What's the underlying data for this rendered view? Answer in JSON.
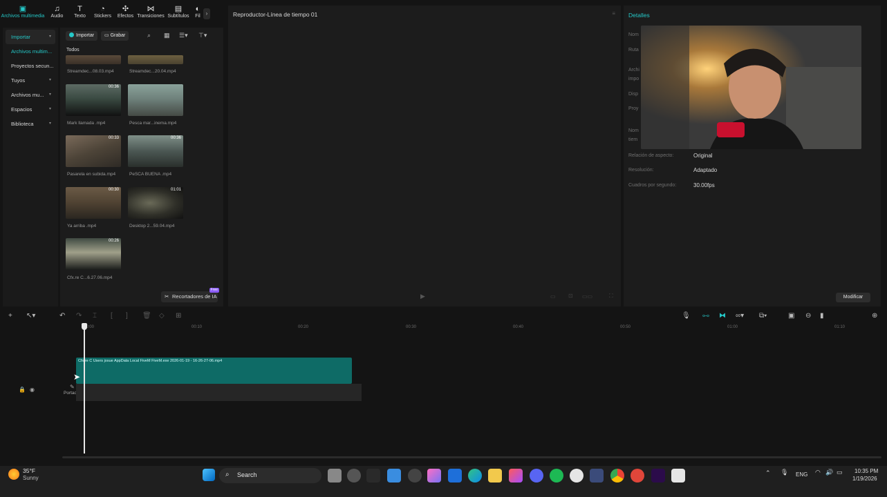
{
  "top_tabs": [
    {
      "label": "Archivos multimedia",
      "icon": "media-icon"
    },
    {
      "label": "Audio",
      "icon": "audio-icon"
    },
    {
      "label": "Texto",
      "icon": "text-icon"
    },
    {
      "label": "Stickers",
      "icon": "sticker-icon"
    },
    {
      "label": "Efectos",
      "icon": "effects-icon"
    },
    {
      "label": "Transiciones",
      "icon": "transitions-icon"
    },
    {
      "label": "Subtítulos",
      "icon": "subtitles-icon"
    },
    {
      "label": "Fil",
      "icon": "filter-icon"
    }
  ],
  "sidebar": {
    "items": [
      {
        "label": "Importar",
        "chevron": "▾"
      },
      {
        "label": "Archivos multim..."
      },
      {
        "label": "Proyectos secun..."
      },
      {
        "label": "Tuyos",
        "chevron": "▾"
      },
      {
        "label": "Archivos mu...",
        "chevron": "▾"
      },
      {
        "label": "Espacios",
        "chevron": "▾"
      },
      {
        "label": "Biblioteca",
        "chevron": "▾"
      }
    ]
  },
  "media": {
    "import_label": "Importar",
    "record_label": "Grabar",
    "filter_label": "Todos",
    "ai_button": "Recortadores de IA",
    "ai_badge": "Free",
    "items": [
      {
        "name": "Streamdec...08.03.mp4",
        "duration": ""
      },
      {
        "name": "Streamdec...20.04.mp4",
        "duration": ""
      },
      {
        "name": "Mark llamada .mp4",
        "duration": "00:36"
      },
      {
        "name": "Pesca mar...inema.mp4",
        "duration": ""
      },
      {
        "name": "Pasarela en subida.mp4",
        "duration": "00:33"
      },
      {
        "name": "PeSCA BUENA .mp4",
        "duration": "00:36"
      },
      {
        "name": "Ya arriba .mp4",
        "duration": "00:30"
      },
      {
        "name": "Desktop 2...59.04.mp4",
        "duration": "01:01"
      },
      {
        "name": "Cfx.re  C...6.27.06.mp4",
        "duration": "00:26"
      }
    ]
  },
  "player": {
    "title": "Reproductor-Línea de tiempo 01"
  },
  "details": {
    "title": "Detalles",
    "rows": [
      {
        "label": "Nom",
        "value": ""
      },
      {
        "label": "Ruta",
        "value": ""
      },
      {
        "label": "Archi",
        "value": ""
      },
      {
        "label": "impo",
        "value": ""
      },
      {
        "label": "Disp",
        "value": ""
      },
      {
        "label": "Proy",
        "value": ""
      },
      {
        "label": "Nom",
        "value": ""
      },
      {
        "label": "tiem",
        "value": ""
      },
      {
        "label": "Relación de aspecto:",
        "value": "Original"
      },
      {
        "label": "Resolución:",
        "value": "Adaptado"
      },
      {
        "label": "Cuadros por segundo:",
        "value": "30.00fps"
      }
    ],
    "modify_label": "Modificar"
  },
  "timeline": {
    "ticks": [
      "00:00",
      "00:10",
      "00:20",
      "00:30",
      "00:40",
      "00:50",
      "01:00",
      "01:10"
    ],
    "clip_label": "Cfx.re  C  Users  josue  AppData  Local  FiveM  FiveM.exe  2026-01-19 - 16-26-27-06.mp4",
    "cover_label": "Portada"
  },
  "taskbar": {
    "weather_temp": "35°F",
    "weather_desc": "Sunny",
    "search_label": "Search",
    "lang": "ENG",
    "time": "10:35 PM",
    "date": "1/19/2026"
  }
}
